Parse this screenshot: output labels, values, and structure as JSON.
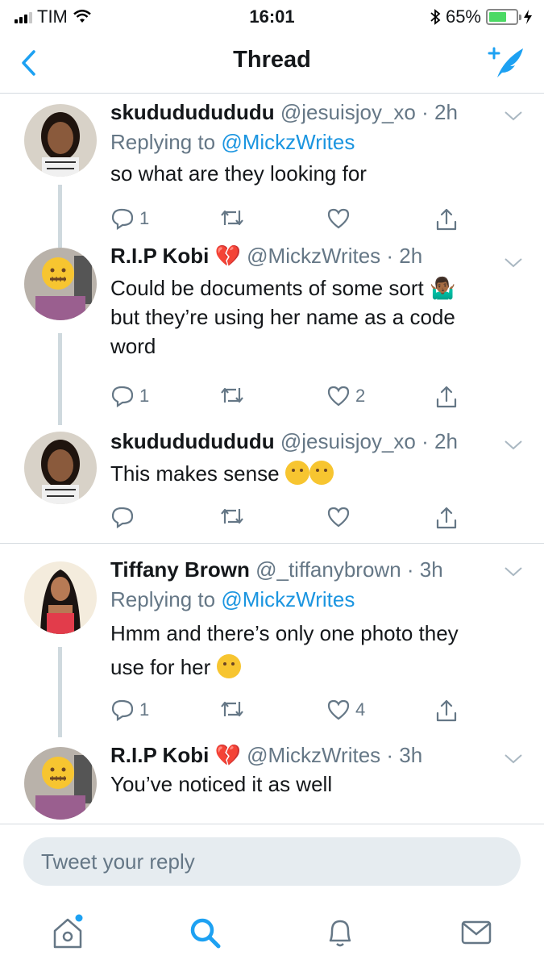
{
  "status_bar": {
    "carrier": "TIM",
    "time": "16:01",
    "battery": "65%",
    "battery_level": 0.65
  },
  "nav": {
    "title": "Thread",
    "back_icon": "chevron-left-icon",
    "compose_icon": "compose-tweet-icon"
  },
  "tweets": [
    {
      "name": "skudududududu",
      "handle": "@jesuisjoy_xo",
      "time": "· 2h",
      "replying_prefix": "Replying to ",
      "replying_to": "@MickzWrites",
      "text": "so what are they looking for",
      "reply_count": "1",
      "retweet_count": "",
      "like_count": ""
    },
    {
      "name": "R.I.P Kobi",
      "name_emoji": "💔",
      "handle": "@MickzWrites",
      "time": "· 2h",
      "text_line1": "Could be documents of some sort 🤷🏾‍♂️",
      "text_line2": "but they’re using her name as a code",
      "text_line3": "word",
      "reply_count": "1",
      "retweet_count": "",
      "like_count": "2"
    },
    {
      "name": "skudududududu",
      "handle": "@jesuisjoy_xo",
      "time": "· 2h",
      "text": "This makes sense",
      "reply_count": "",
      "retweet_count": "",
      "like_count": ""
    },
    {
      "name": "Tiffany Brown",
      "handle": "@_tiffanybrown",
      "time": "· 3h",
      "replying_prefix": "Replying to ",
      "replying_to": "@MickzWrites",
      "text_line1": "Hmm and there’s only one photo they",
      "text_line2": "use for her",
      "reply_count": "1",
      "retweet_count": "",
      "like_count": "4"
    },
    {
      "name": "R.I.P Kobi",
      "name_emoji": "💔",
      "handle": "@MickzWrites",
      "time": "· 3h",
      "text": "You’ve noticed it as well"
    }
  ],
  "reply": {
    "placeholder": "Tweet your reply"
  },
  "tab_bar": {
    "items": [
      "home-icon",
      "search-icon",
      "notifications-icon",
      "messages-icon"
    ],
    "active": "search-icon",
    "accent": "#1da1f2"
  },
  "colors": {
    "accent": "#1da1f2",
    "mention": "#1b95e0",
    "secondary_text": "#657786",
    "battery_fill": "#4cd964"
  }
}
